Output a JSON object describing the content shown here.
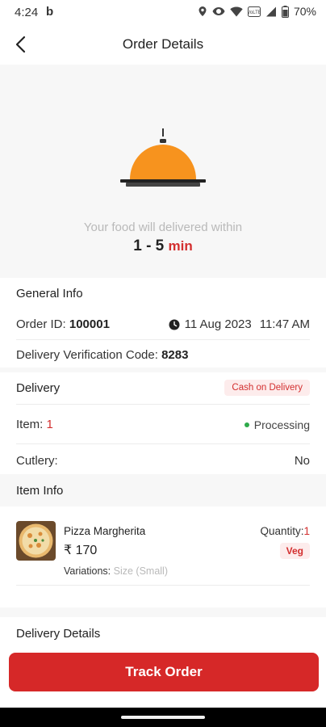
{
  "status_bar": {
    "time": "4:24",
    "b_icon": "b",
    "battery": "70%",
    "icons": [
      "location-icon",
      "eye-icon",
      "wifi-icon",
      "volte-icon",
      "signal-icon",
      "battery-icon"
    ]
  },
  "app_bar": {
    "title": "Order Details",
    "back_icon": "back-arrow-icon"
  },
  "hero": {
    "icon": "food-cloche-icon",
    "message": "Your food will delivered within",
    "time_range": "1 - 5",
    "time_unit": "min"
  },
  "general_info": {
    "title": "General Info",
    "order_id_label": "Order ID:",
    "order_id": "100001",
    "date": "11 Aug 2023",
    "time": "11:47 AM",
    "verification_label": "Delivery Verification Code:",
    "verification_code": "8283",
    "delivery_label": "Delivery",
    "payment_badge": "Cash on Delivery",
    "item_label": "Item:",
    "item_count": "1",
    "status": "Processing",
    "cutlery_label": "Cutlery:",
    "cutlery_value": "No"
  },
  "item_info": {
    "title": "Item Info",
    "items": [
      {
        "name": "Pizza Margherita",
        "price": "₹ 170",
        "quantity_label": "Quantity:",
        "quantity": "1",
        "tag": "Veg",
        "variations_label": "Variations:",
        "variations": "Size (Small)"
      }
    ]
  },
  "delivery_details": {
    "title": "Delivery Details"
  },
  "actions": {
    "track_order": "Track Order"
  },
  "colors": {
    "primary": "#d62828",
    "accent_orange": "#f7931e",
    "success": "#2eaa4a"
  }
}
